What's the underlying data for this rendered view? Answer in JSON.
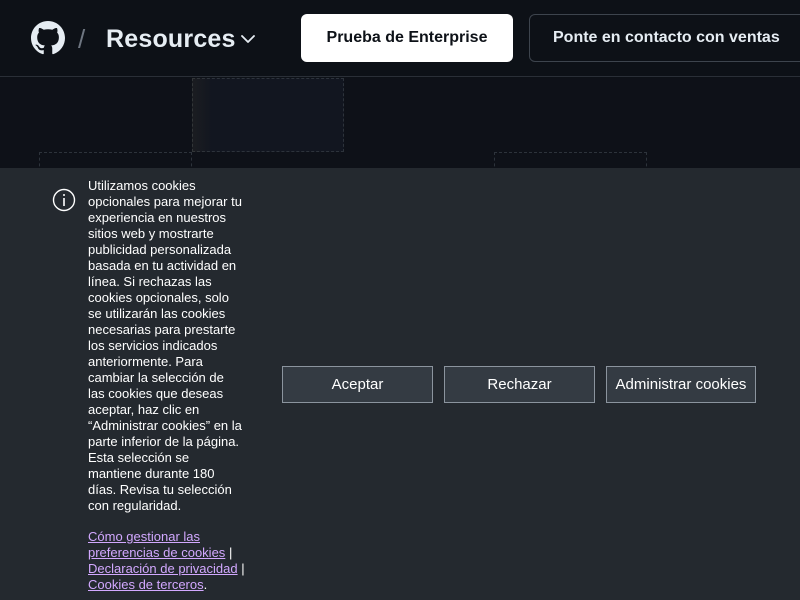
{
  "header": {
    "separator": "/",
    "section_title": "Resources",
    "enterprise_button": "Prueba de Enterprise",
    "sales_button": "Ponte en contacto con ventas"
  },
  "cookie_banner": {
    "message": "Utilizamos cookies opcionales para mejorar tu experiencia en nuestros sitios web y mostrarte publicidad personalizada basada en tu actividad en línea. Si rechazas las cookies opcionales, solo se utilizarán las cookies necesarias para prestarte los servicios indicados anteriormente. Para cambiar la selección de las cookies que deseas aceptar, haz clic en “Administrar cookies” en la parte inferior de la página. Esta selección se mantiene durante 180 días. Revisa tu selección con regularidad.",
    "link_manage_prefs": "Cómo gestionar las preferencias de cookies",
    "link_privacy": "Declaración de privacidad",
    "link_third_party": "Cookies de terceros",
    "separator": "|",
    "trailing_period": ".",
    "accept_button": "Aceptar",
    "reject_button": "Rechazar",
    "manage_button": "Administrar cookies"
  },
  "colors": {
    "link": "#d2a8ff",
    "banner_bg": "#24292f",
    "page_bg": "#0d1117"
  },
  "icons": [
    "github-logo-icon",
    "chevron-down-icon",
    "info-icon"
  ]
}
